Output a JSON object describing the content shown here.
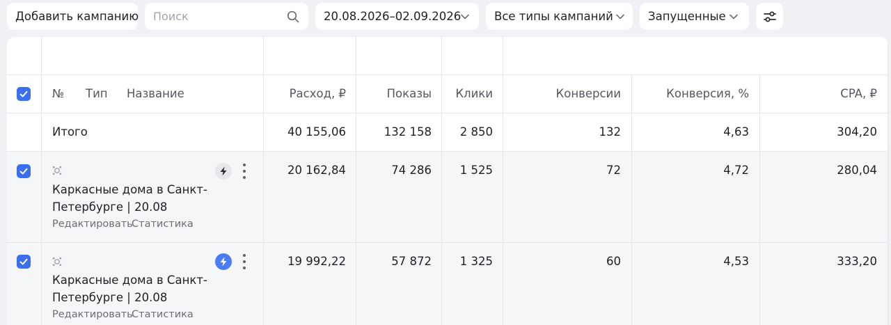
{
  "toolbar": {
    "add_label": "Добавить кампанию",
    "search_placeholder": "Поиск",
    "date_range": "20.08.2026–02.09.2026",
    "campaign_type": "Все типы кампаний",
    "status": "Запущенные"
  },
  "table": {
    "headers": {
      "number": "№",
      "type": "Тип",
      "name": "Название",
      "spend": "Расход, ₽",
      "impressions": "Показы",
      "clicks": "Клики",
      "conversions": "Конверсии",
      "conversion_rate": "Конверсия, %",
      "cpa": "CPA, ₽"
    },
    "total": {
      "label": "Итого",
      "spend": "40 155,06",
      "impressions": "132 158",
      "clicks": "2 850",
      "conversions": "132",
      "conversion_rate": "4,63",
      "cpa": "304,20"
    },
    "rows": [
      {
        "name": "Каркасные дома в Санкт-Петербурге | 20.08",
        "edit_label": "Редактировать",
        "stats_label": "Статистика",
        "spend": "20 162,84",
        "impressions": "74 286",
        "clicks": "1 525",
        "conversions": "72",
        "conversion_rate": "4,72",
        "cpa": "280,04",
        "autotarget": "inactive"
      },
      {
        "name": "Каркасные дома в Санкт-Петербурге | 20.08",
        "edit_label": "Редактировать",
        "stats_label": "Статистика",
        "spend": "19 992,22",
        "impressions": "57 872",
        "clicks": "1 325",
        "conversions": "60",
        "conversion_rate": "4,53",
        "cpa": "333,20",
        "autotarget": "active"
      }
    ]
  },
  "colors": {
    "accent": "#3b6ff0",
    "page_bg": "#f0f1f5",
    "row_bg": "#f5f6f8",
    "border": "#e4e5e9"
  },
  "icons": [
    "search-icon",
    "chevron-down-icon",
    "filter-settings-icon",
    "checkbox-checked-icon",
    "campaign-type-icon",
    "lightning-icon",
    "more-vertical-icon"
  ]
}
